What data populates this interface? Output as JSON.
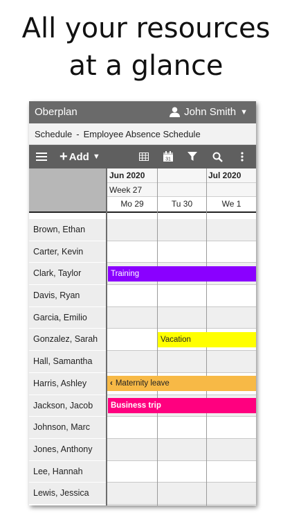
{
  "promo": {
    "line1": "All your resources",
    "line2": "at a glance"
  },
  "app": {
    "title": "Oberplan",
    "user_name": "John Smith"
  },
  "breadcrumb": {
    "section": "Schedule",
    "separator": "-",
    "page": "Employee Absence Schedule"
  },
  "toolbar": {
    "add_label": "Add",
    "icons": [
      "menu-icon",
      "plus-icon",
      "chevron-down-icon",
      "grid-view-icon",
      "calendar-icon",
      "filter-icon",
      "search-icon",
      "more-vertical-icon"
    ],
    "calendar_day": "31"
  },
  "header": {
    "months": [
      "Jun 2020",
      "Jul 2020"
    ],
    "week": "Week 27",
    "days": [
      "Mo 29",
      "Tu 30",
      "We 1"
    ]
  },
  "employees": [
    "Brown, Ethan",
    "Carter, Kevin",
    "Clark, Taylor",
    "Davis, Ryan",
    "Garcia, Emilio",
    "Gonzalez, Sarah",
    "Hall, Samantha",
    "Harris, Ashley",
    "Jackson, Jacob",
    "Johnson, Marc",
    "Jones, Anthony",
    "Lee, Hannah",
    "Lewis, Jessica"
  ],
  "events": [
    {
      "label": "Training",
      "employee": "Clark, Taylor",
      "start_day": "Mo 29",
      "continues": true,
      "color": "#8a00ff",
      "text_color": "#ffffff",
      "bold": false
    },
    {
      "label": "Vacation",
      "employee": "Gonzalez, Sarah",
      "start_day": "Tu 30",
      "continues": true,
      "color": "#ffff00",
      "text_color": "#222222",
      "bold": false
    },
    {
      "label": "Maternity leave",
      "employee": "Harris, Ashley",
      "start_day": "before Mo 29",
      "continues": true,
      "color": "#f7b946",
      "text_color": "#222222",
      "bold": false,
      "arrow": "chevron-left-icon"
    },
    {
      "label": "Business trip",
      "employee": "Jackson, Jacob",
      "start_day": "Mo 29",
      "continues": true,
      "color": "#ff007f",
      "text_color": "#ffffff",
      "bold": true
    }
  ],
  "colors": {
    "topbar": "#6a6a6a",
    "toolbar": "#5f5f5f",
    "breadcrumb_bg": "#f2f2f2"
  }
}
